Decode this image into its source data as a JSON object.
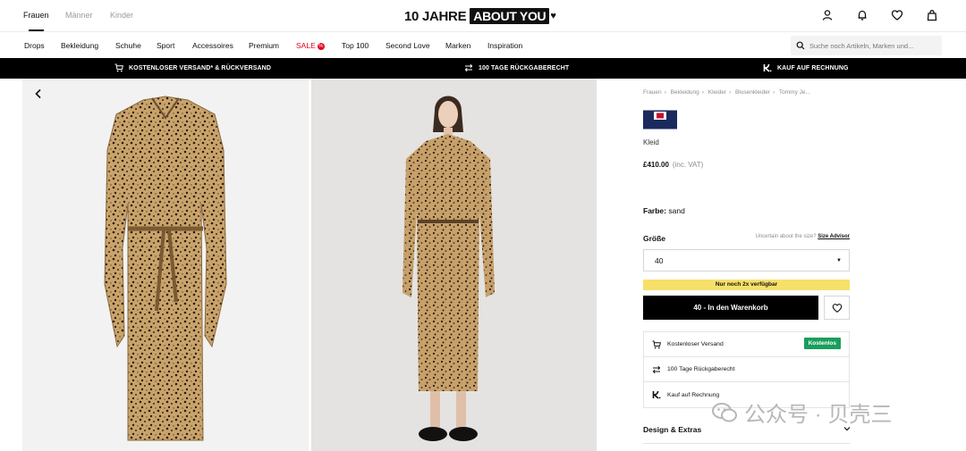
{
  "header": {
    "genders": [
      "Frauen",
      "Männer",
      "Kinder"
    ],
    "logo_text": "10 JAHRE",
    "logo_box": "ABOUT YOU",
    "icons": [
      "user-icon",
      "bell-icon",
      "heart-icon",
      "bag-icon"
    ]
  },
  "nav": {
    "items": [
      "Drops",
      "Bekleidung",
      "Schuhe",
      "Sport",
      "Accessoires",
      "Premium",
      "SALE",
      "Top 100",
      "Second Love",
      "Marken",
      "Inspiration"
    ],
    "sale_badge": "%"
  },
  "search": {
    "placeholder": "Suche noch Artikeln, Marken und..."
  },
  "promo": {
    "shipping": "KOSTENLOSER VERSAND* & RÜCKVERSAND",
    "returns": "100 TAGE RÜCKGABERECHT",
    "invoice": "KAUF AUF RECHNUNG"
  },
  "product": {
    "breadcrumb": [
      "Frauen",
      "Bekleidung",
      "Kleider",
      "Blusenkleider",
      "Tommy Je..."
    ],
    "title": "Kleid",
    "price": "£410.00",
    "vat": "(inc. VAT)",
    "color_label": "Farbe:",
    "color_value": "sand",
    "size_label": "Größe",
    "size_hint": "Uncertain about the size?",
    "size_advisor": "Size Advisor",
    "size_selected": "40",
    "stock_notice": "Nur noch 2x verfügbar",
    "cart_button": "40 - In den Warenkorb",
    "info": {
      "shipping": "Kostenloser Versand",
      "shipping_badge": "Kostenlos",
      "returns": "100 Tage Rückgaberecht",
      "invoice": "Kauf auf Rechnung"
    },
    "design_section": "Design & Extras"
  },
  "watermark": "公众号 · 贝壳三",
  "colors": {
    "accent": "#000000",
    "sale": "#e3001b",
    "stock": "#f7e06a",
    "free_badge": "#1a9e5c"
  }
}
